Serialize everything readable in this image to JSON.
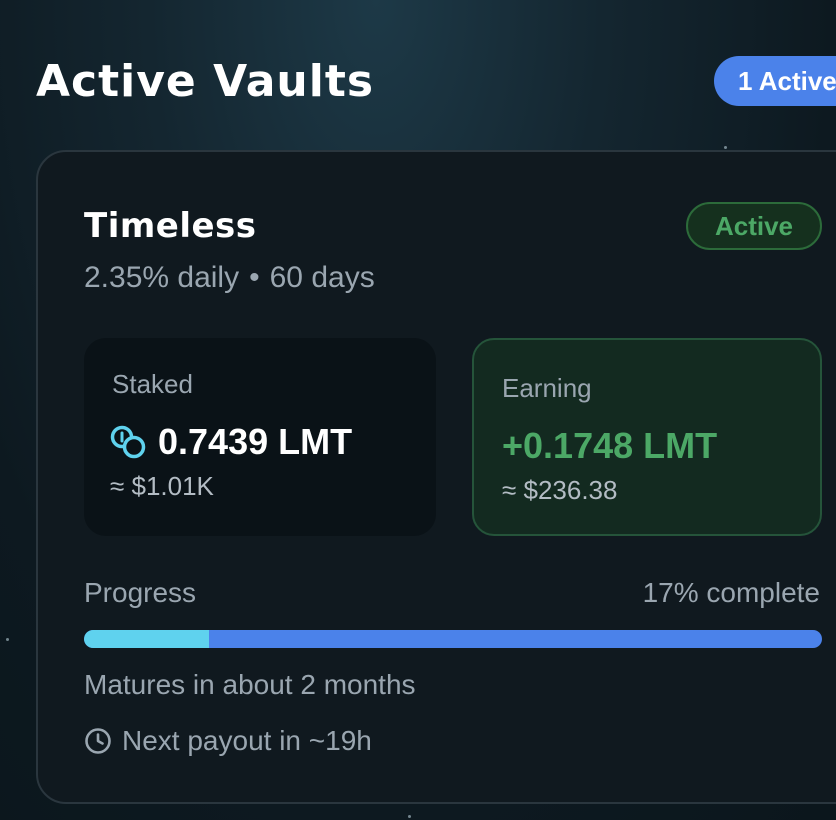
{
  "section": {
    "title": "Active Vaults",
    "count_badge": "1 Active"
  },
  "vault": {
    "name": "Timeless",
    "status": "Active",
    "rate": "2.35% daily",
    "separator": "•",
    "duration": "60 days",
    "staked": {
      "label": "Staked",
      "icon": "coin-stack-icon",
      "value": "0.7439 LMT",
      "usd": "≈ $1.01K"
    },
    "earning": {
      "label": "Earning",
      "value": "+0.1748 LMT",
      "usd": "≈ $236.38"
    },
    "progress": {
      "label": "Progress",
      "percent_text": "17% complete",
      "fraction": 0.17
    },
    "maturity": "Matures in about 2 months",
    "payout": {
      "icon": "clock-icon",
      "text": "Next payout in ~19h"
    }
  },
  "colors": {
    "accent_blue": "#4b82ea",
    "progress_cyan": "#5fd2ee",
    "success_green": "#4ca866"
  }
}
